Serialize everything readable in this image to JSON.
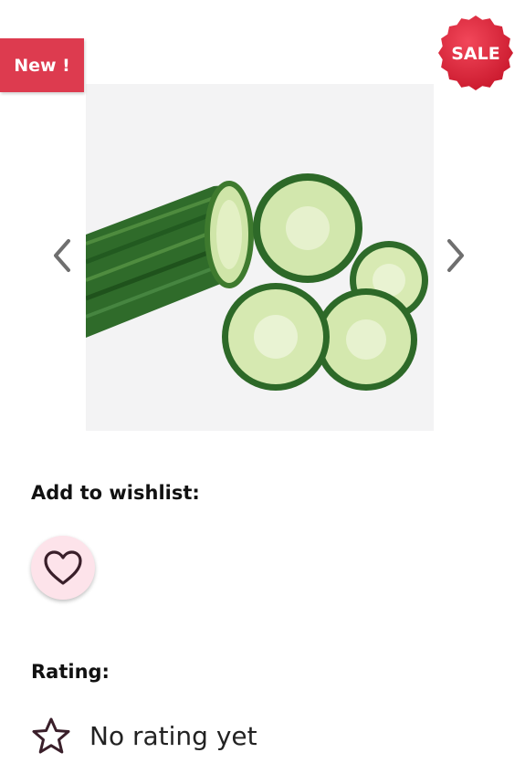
{
  "badges": {
    "new_label": "New !",
    "sale_label": "SALE"
  },
  "product_image": {
    "subject": "sliced cucumber"
  },
  "carousel": {
    "prev_icon": "chevron-left-icon",
    "next_icon": "chevron-right-icon"
  },
  "wishlist": {
    "label": "Add to wishlist:",
    "icon": "heart-outline-icon"
  },
  "rating": {
    "label": "Rating:",
    "icon": "star-outline-icon",
    "value_text": "No rating yet"
  },
  "colors": {
    "new_badge": "#dd3b4f",
    "sale_badge": "#e5283c",
    "wishlist_bg": "#fde3ea",
    "icon_stroke": "#3a1f2a"
  }
}
